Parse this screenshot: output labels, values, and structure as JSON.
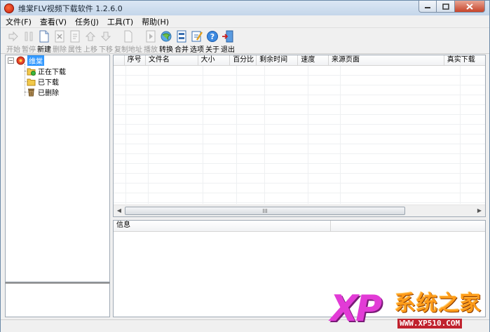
{
  "window": {
    "title": "维棠FLV视频下载软件 1.2.6.0"
  },
  "menu": [
    {
      "label": "文件(F)"
    },
    {
      "label": "查看(V)"
    },
    {
      "label": "任务(J)"
    },
    {
      "label": "工具(T)"
    },
    {
      "label": "帮助(H)"
    }
  ],
  "toolbar": [
    {
      "label": "开始",
      "icon": "play-arrow-icon",
      "enabled": false
    },
    {
      "label": "暂停",
      "icon": "pause-icon",
      "enabled": false
    },
    {
      "label": "新建",
      "icon": "new-document-icon",
      "enabled": true
    },
    {
      "label": "删除",
      "icon": "delete-x-icon",
      "enabled": false
    },
    {
      "label": "属性",
      "icon": "properties-icon",
      "enabled": false
    },
    {
      "label": "上移",
      "icon": "move-up-icon",
      "enabled": false
    },
    {
      "label": "下移",
      "icon": "move-down-icon",
      "enabled": false
    },
    {
      "label": "复制地址",
      "icon": "copy-address-icon",
      "enabled": false
    },
    {
      "label": "播放",
      "icon": "play-file-icon",
      "enabled": false
    },
    {
      "label": "转换",
      "icon": "convert-globe-icon",
      "enabled": true
    },
    {
      "label": "合并",
      "icon": "merge-icon",
      "enabled": true
    },
    {
      "label": "选项",
      "icon": "options-icon",
      "enabled": true
    },
    {
      "label": "关于",
      "icon": "about-help-icon",
      "enabled": true
    },
    {
      "label": "退出",
      "icon": "exit-door-icon",
      "enabled": true
    }
  ],
  "tree": {
    "root": {
      "label": "维棠",
      "expander": "⊟"
    },
    "children": [
      {
        "label": "正在下载",
        "icon": "downloading-folder-icon"
      },
      {
        "label": "已下载",
        "icon": "downloaded-folder-icon"
      },
      {
        "label": "已删除",
        "icon": "trash-icon"
      }
    ]
  },
  "list": {
    "columns": [
      "",
      "序号",
      "文件名",
      "大小",
      "百分比",
      "剩余时间",
      "速度",
      "来源页面",
      "真实下载"
    ],
    "scroll_grip": "III"
  },
  "info": {
    "columns": [
      "信息",
      ""
    ]
  },
  "watermark": {
    "logo": "XP",
    "name": "系统之家",
    "url": "WWW.XP510.COM"
  },
  "colors": {
    "selection": "#3399ff",
    "watermark_magenta": "#e23bd6",
    "watermark_orange": "#ff9c1a",
    "disabled_text": "#9b9b9b"
  }
}
